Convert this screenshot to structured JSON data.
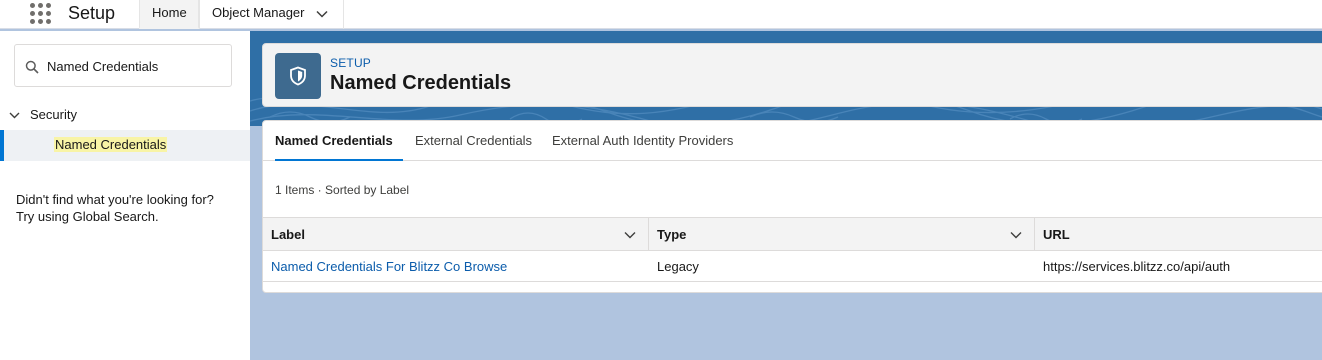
{
  "topbar": {
    "app_name": "Setup",
    "tabs": [
      {
        "label": "Home"
      },
      {
        "label": "Object Manager"
      }
    ]
  },
  "sidebar": {
    "search_value": "Named Credentials",
    "tree": {
      "section_label": "Security",
      "item_label": "Named Credentials"
    },
    "help_line1": "Didn't find what you're looking for?",
    "help_line2": "Try using Global Search."
  },
  "header": {
    "eyebrow": "SETUP",
    "title": "Named Credentials",
    "icon": "shield-icon"
  },
  "tabs": [
    {
      "label": "Named Credentials",
      "active": true
    },
    {
      "label": "External Credentials",
      "active": false
    },
    {
      "label": "External Auth Identity Providers",
      "active": false
    }
  ],
  "list_meta": "1 Items · Sorted by Label",
  "table": {
    "columns": [
      "Label",
      "Type",
      "URL"
    ],
    "rows": [
      {
        "label": "Named Credentials For Blitzz Co Browse",
        "type": "Legacy",
        "url": "https://services.blitzz.co/api/auth"
      }
    ]
  },
  "colors": {
    "brand": "#0176d3",
    "link": "#0b5cab",
    "icon_bg": "#3e6a8f",
    "background": "#b0c4df"
  }
}
